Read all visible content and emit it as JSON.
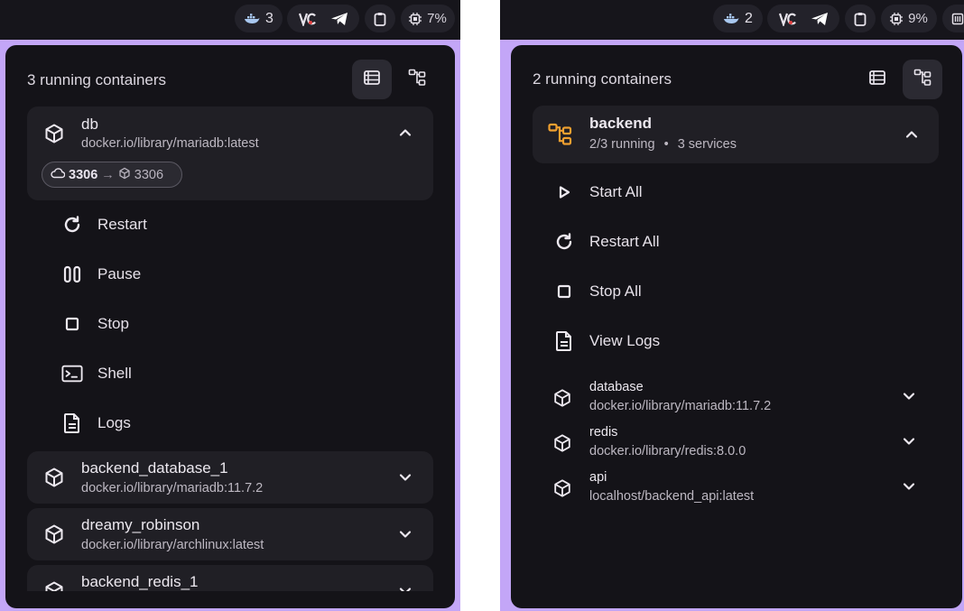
{
  "left": {
    "topbar": {
      "container_count": "3",
      "cpu": "7%"
    },
    "header_title": "3 running containers",
    "containers": [
      {
        "name": "db",
        "image": "docker.io/library/mariadb:latest",
        "expanded": true,
        "port": {
          "host": "3306",
          "arrow": "→",
          "container": "3306"
        }
      },
      {
        "name": "backend_database_1",
        "image": "docker.io/library/mariadb:11.7.2"
      },
      {
        "name": "dreamy_robinson",
        "image": "docker.io/library/archlinux:latest"
      },
      {
        "name": "backend_redis_1",
        "image": ""
      }
    ],
    "actions": [
      {
        "label": "Restart",
        "icon": "restart-icon"
      },
      {
        "label": "Pause",
        "icon": "pause-icon"
      },
      {
        "label": "Stop",
        "icon": "stop-icon"
      },
      {
        "label": "Shell",
        "icon": "terminal-icon"
      },
      {
        "label": "Logs",
        "icon": "document-icon"
      }
    ]
  },
  "right": {
    "topbar": {
      "container_count": "2",
      "cpu": "9%"
    },
    "header_title": "2 running containers",
    "project": {
      "name": "backend",
      "running": "2/3 running",
      "separator": "•",
      "services_count": "3 services"
    },
    "actions": [
      {
        "label": "Start All",
        "icon": "play-icon"
      },
      {
        "label": "Restart All",
        "icon": "restart-icon"
      },
      {
        "label": "Stop All",
        "icon": "stop-icon"
      },
      {
        "label": "View Logs",
        "icon": "document-icon"
      }
    ],
    "services": [
      {
        "name": "database",
        "image": "docker.io/library/mariadb:11.7.2"
      },
      {
        "name": "redis",
        "image": "docker.io/library/redis:8.0.0"
      },
      {
        "name": "api",
        "image": "localhost/backend_api:latest"
      }
    ]
  },
  "colors": {
    "accent_border": "#c3a6f7",
    "panel_bg": "#141318",
    "card_bg": "#201f25",
    "project_icon": "#f0a030"
  }
}
